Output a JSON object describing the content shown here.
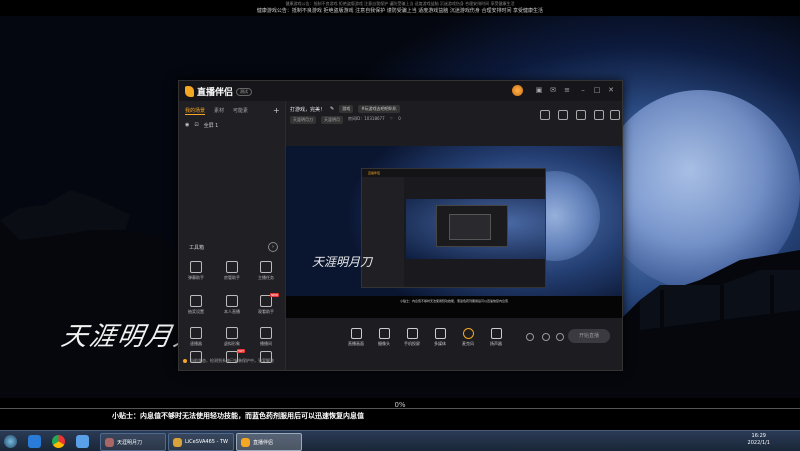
{
  "topbar": {
    "line1": "健康游戏公告：抵制不良游戏 拒绝盗版游戏 注意自我保护 谨防受骗上当 适度游戏益脑 沉迷游戏伤身 合理安排时间 享受健康生活",
    "line2": "健康游戏公告：抵制不良游戏 拒绝盗版游戏 注意自我保护 谨防受骗上当 适度游戏益脑 沉迷游戏伤身 合理安排时间 享受健康生活"
  },
  "game": {
    "calligraphy": "天涯明月刀",
    "progress_percent": 0,
    "progress_label": "0%",
    "tip": "小贴士：内息值不够时无法使用轻功技能，而蓝色药剂服用后可以迅速恢复内息值"
  },
  "app": {
    "name": "直播伴侣",
    "version": "测试",
    "left_tabs": [
      {
        "label": "我的场景",
        "active": true
      },
      {
        "label": "素材",
        "active": false
      },
      {
        "label": "可能素",
        "active": false
      }
    ],
    "add_label": "+",
    "scene_item": "全屏 1",
    "tools_header": "工具箱",
    "tools_more": "›",
    "tools": [
      {
        "label": "弹幕助手"
      },
      {
        "label": "房管助手"
      },
      {
        "label": "主播任务"
      },
      {
        "label": "抽奖设置"
      },
      {
        "label": "本人直播"
      },
      {
        "label": "观看助手",
        "hot": "NEW"
      },
      {
        "label": "速播器"
      },
      {
        "label": "虚拟形象"
      },
      {
        "label": "播播间"
      },
      {
        "label": "游戏"
      },
      {
        "label": "更多",
        "hot": "HOT"
      },
      {
        "label": "设置"
      }
    ],
    "footer": "当前状态，检测到系统已安装保护中，答案解答",
    "room_title": "打游戏，完美！",
    "room_edit_icon": "edit-icon",
    "room_category": "游戏",
    "room_tag": "#玩游戏去吧吧叭叭",
    "room_sub1": "天涯明月刀",
    "room_sub2": "天涯明月",
    "room_id_label": "房间ID：10318677",
    "room_likes": "0",
    "preview_tip": "小贴士：内息值不够时无法使用轻功技能，而蓝色药剂服用后可以迅速恢复内息值",
    "preview_calligraphy": "天涯明月刀",
    "nested_app_name": "直播伴侣",
    "controls": [
      {
        "label": "直播画面",
        "icon": "screen-icon"
      },
      {
        "label": "摄像头",
        "icon": "camera-icon"
      },
      {
        "label": "手机投屏",
        "icon": "phone-icon"
      },
      {
        "label": "多媒体",
        "icon": "media-icon"
      },
      {
        "label": "麦克风",
        "icon": "mic-icon"
      },
      {
        "label": "扬声器",
        "icon": "speaker-icon"
      }
    ],
    "start_label": "开始直播"
  },
  "taskbar": {
    "apps": [
      {
        "label": "天涯明月刀",
        "active": false
      },
      {
        "label": "LiCeSVA465 - TW",
        "active": false
      },
      {
        "label": "直播伴侣",
        "active": true
      }
    ],
    "time": "16:29",
    "date": "2022/1/1"
  }
}
